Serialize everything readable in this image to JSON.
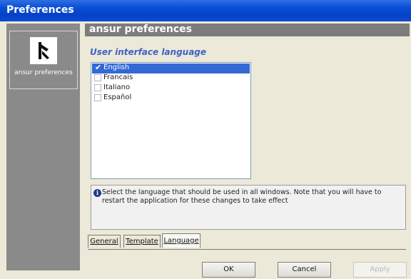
{
  "window": {
    "title": "Preferences"
  },
  "sidebar": {
    "items": [
      {
        "label": "ansur preferences",
        "icon": "ansur-logo-icon"
      }
    ]
  },
  "header": {
    "title": "ansur preferences"
  },
  "section": {
    "title": "User interface language"
  },
  "languages": [
    {
      "label": "English",
      "checked": true,
      "selected": true
    },
    {
      "label": "Francais",
      "checked": false,
      "selected": false
    },
    {
      "label": "Italiano",
      "checked": false,
      "selected": false
    },
    {
      "label": "Español",
      "checked": false,
      "selected": false
    }
  ],
  "info": {
    "icon": "info-icon",
    "text": "Select the language that should be used in all windows. Note that you will have to restart the application for these changes to take effect"
  },
  "tabs": [
    {
      "label": "General",
      "active": false
    },
    {
      "label": "Template",
      "active": false
    },
    {
      "label": "Language",
      "active": true
    }
  ],
  "buttons": {
    "ok": "OK",
    "cancel": "Cancel",
    "apply": "Apply"
  },
  "colors": {
    "titlebar": "#0a4fd6",
    "selection": "#3269d4",
    "section_title": "#3d62c4",
    "sidebar": "#8a8a8a"
  }
}
